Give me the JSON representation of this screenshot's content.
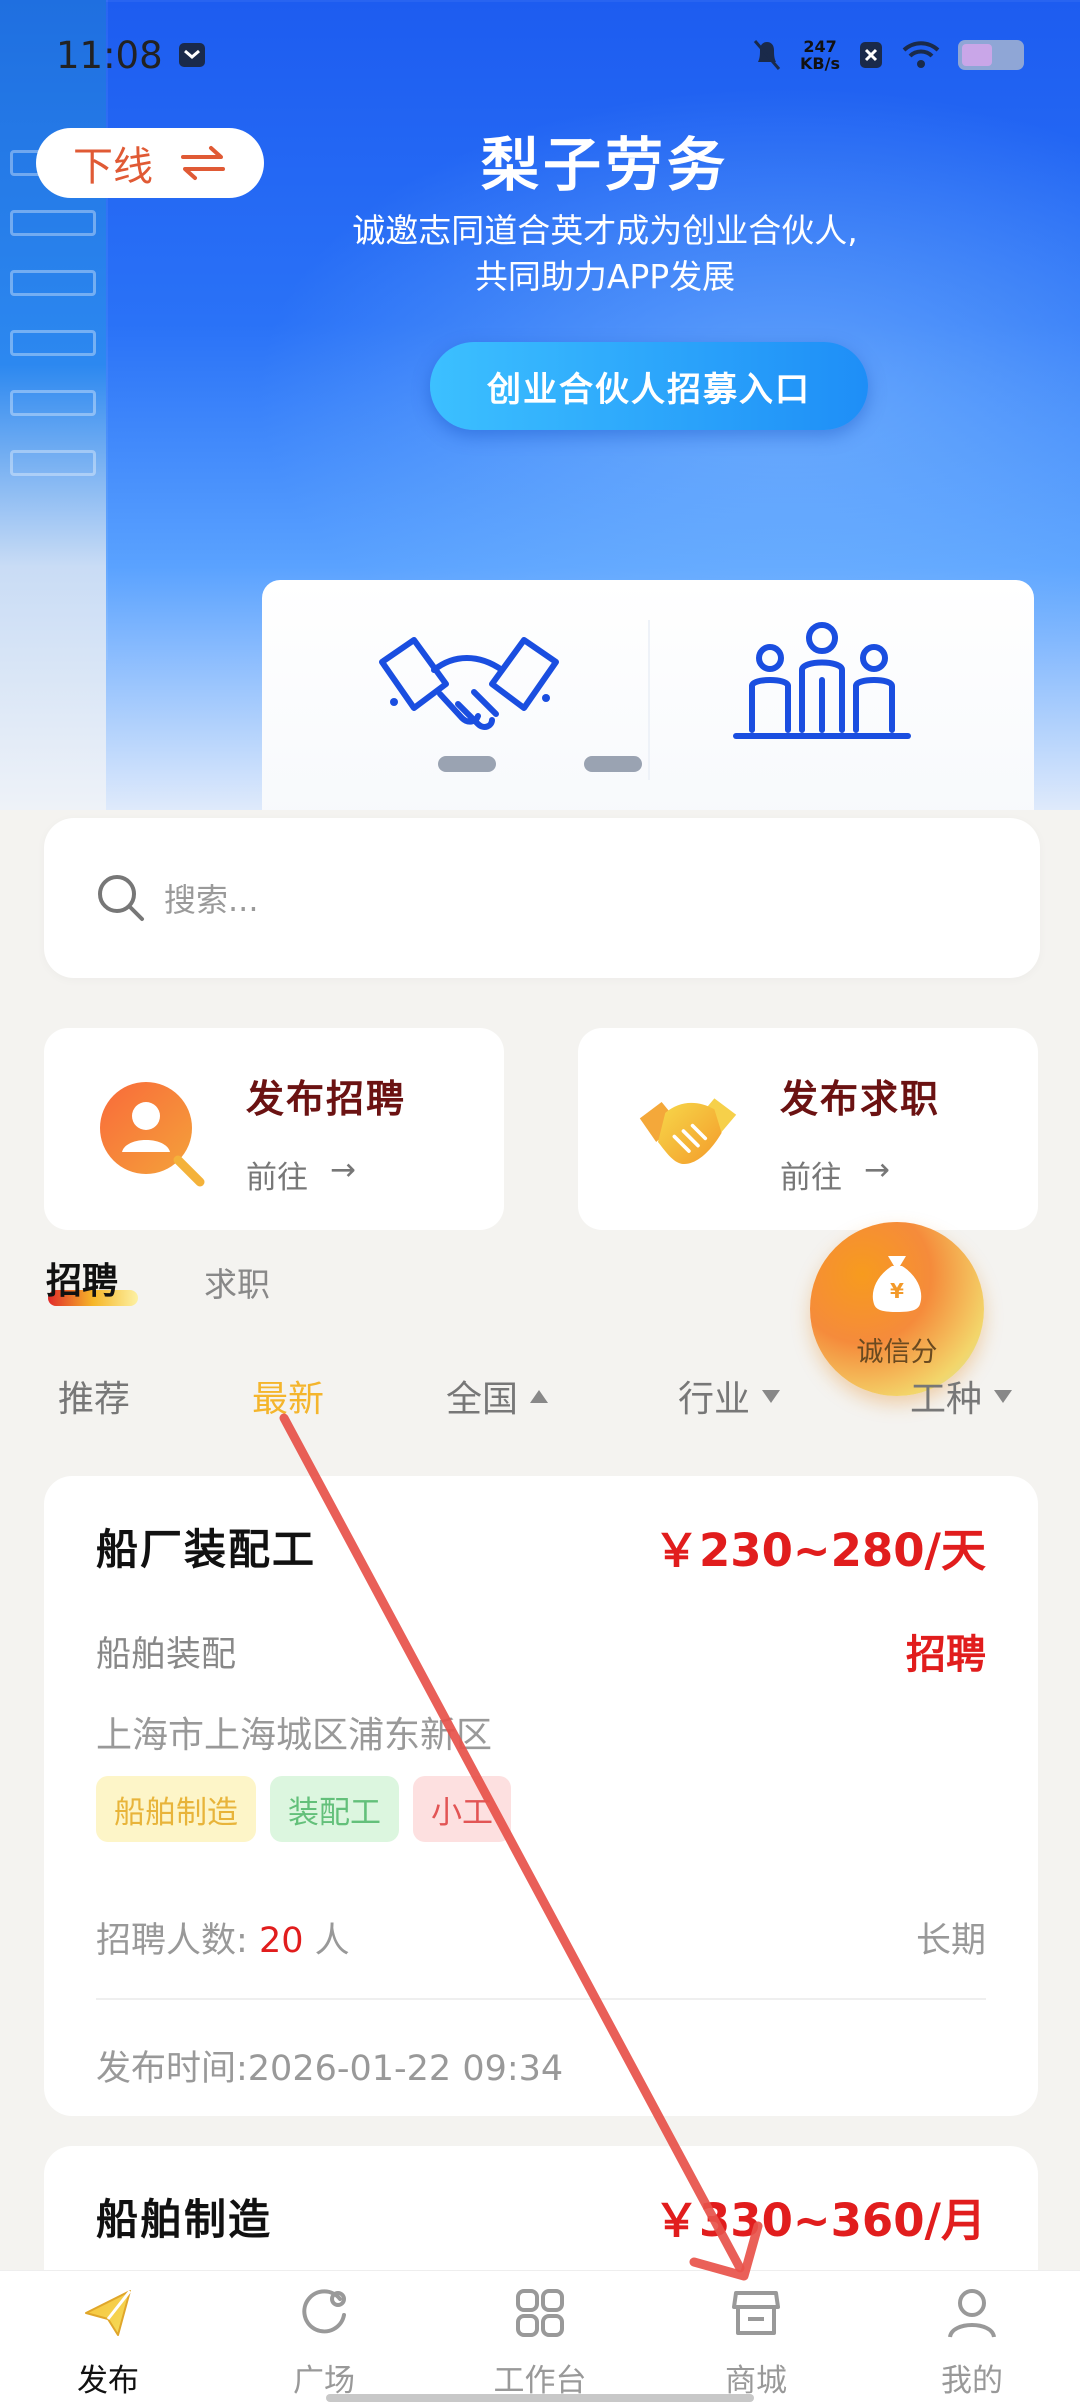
{
  "status_bar": {
    "time": "11:08",
    "net_speed_value": "247",
    "net_speed_unit": "KB/s"
  },
  "banner": {
    "offline_label": "下线",
    "title": "梨子劳务",
    "subtitle_line1": "诚邀志同道合英才成为创业合伙人,",
    "subtitle_line2": "共同助力APP发展",
    "button_label": "创业合伙人招募入口"
  },
  "search": {
    "placeholder": "搜索..."
  },
  "quick_actions": [
    {
      "title": "发布招聘",
      "sub": "前往",
      "arrow": "→"
    },
    {
      "title": "发布求职",
      "sub": "前往",
      "arrow": "→"
    }
  ],
  "tabs": {
    "recruit": "招聘",
    "job_seek": "求职"
  },
  "credit_badge": {
    "label": "诚信分"
  },
  "filters": {
    "recommend": "推荐",
    "latest": "最新",
    "region": "全国",
    "industry": "行业",
    "job_type": "工种"
  },
  "jobs": [
    {
      "title": "船厂装配工",
      "salary": "￥230~280/天",
      "category": "船舶装配",
      "type": "招聘",
      "location": "上海市上海城区浦东新区",
      "tags": [
        "船舶制造",
        "装配工",
        "小工"
      ],
      "count_label": "招聘人数:",
      "count": "20",
      "count_unit": "人",
      "term": "长期",
      "posted": "发布时间:2026-01-22 09:34"
    },
    {
      "title": "船舶制造",
      "salary": "￥330~360/月"
    }
  ],
  "bottom_nav": [
    {
      "label": "发布"
    },
    {
      "label": "广场"
    },
    {
      "label": "工作台"
    },
    {
      "label": "商城"
    },
    {
      "label": "我的"
    }
  ],
  "colors": {
    "accent_red": "#e11d1d",
    "accent_yellow": "#f4b52c",
    "brand_blue": "#1e6ff5"
  }
}
